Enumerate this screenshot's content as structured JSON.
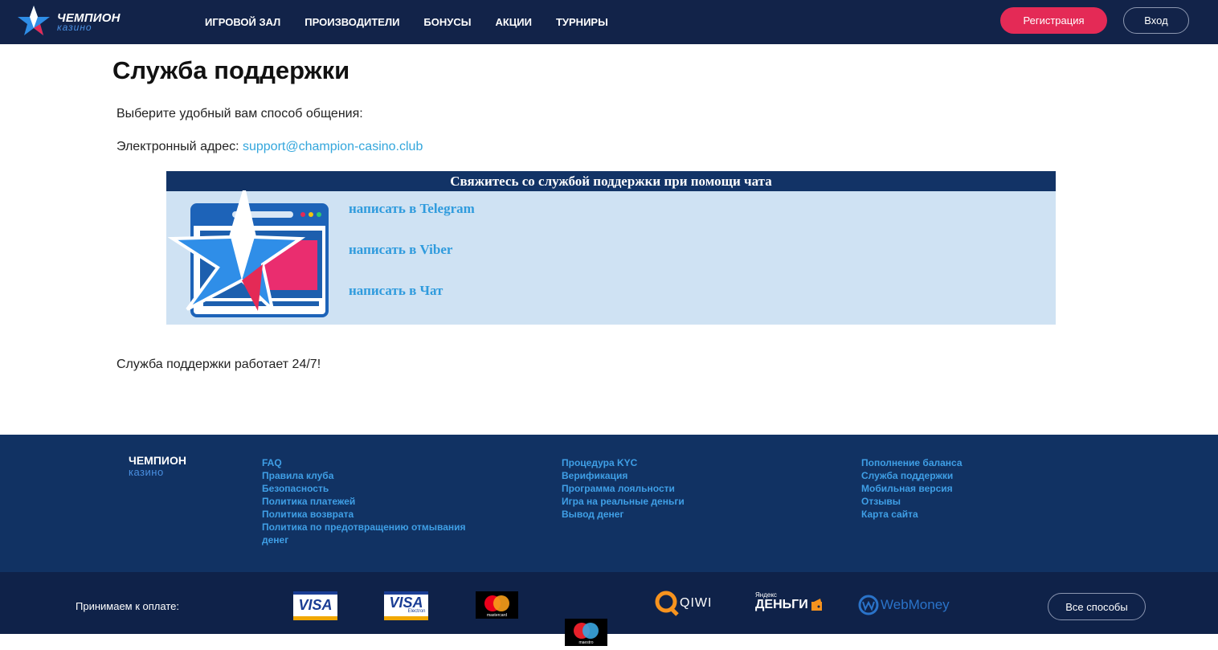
{
  "header": {
    "logo_main": "ЧЕМПИОН",
    "logo_sub": "казино",
    "nav": [
      "ИГРОВОЙ ЗАЛ",
      "ПРОИЗВОДИТЕЛИ",
      "БОНУСЫ",
      "АКЦИИ",
      "ТУРНИРЫ"
    ],
    "register_label": "Регистрация",
    "login_label": "Вход"
  },
  "main": {
    "title": "Служба поддержки",
    "intro": "Выберите удобный вам способ общения:",
    "email_label": "Электронный адрес: ",
    "email": "support@champion-casino.club",
    "chat_heading": "Свяжитесь со службой поддержки при помощи чата",
    "chat_links": [
      "написать в Telegram",
      "написать в Viber",
      "написать в Чат"
    ],
    "hours": "Служба поддержки работает 24/7!"
  },
  "footer": {
    "logo_main": "ЧЕМПИОН",
    "logo_sub": "казино",
    "col1": [
      "FAQ",
      "Правила клуба",
      "Безопасность",
      "Политика платежей",
      "Политика возврата",
      "Политика по предотвращению отмывания",
      "денег"
    ],
    "col2": [
      "Процедура KYC",
      "Верификация",
      "Программа лояльности",
      "Игра на реальные деньги",
      "Вывод денег"
    ],
    "col3": [
      "Пополнение баланса",
      "Служба поддержки",
      "Мобильная версия",
      "Отзывы",
      "Карта сайта"
    ]
  },
  "payments": {
    "label": "Принимаем к оплате:",
    "methods": {
      "visa": "VISA",
      "visa_electron": "VISA",
      "visa_electron_sub": "Electron",
      "mastercard": "mastercard",
      "maestro": "maestro",
      "qiwi": "QIWI",
      "yandex_top": "Яндекс",
      "yandex_main": "ДЕНЬГИ",
      "webmoney": "WebMoney"
    },
    "all_label": "Все способы"
  }
}
